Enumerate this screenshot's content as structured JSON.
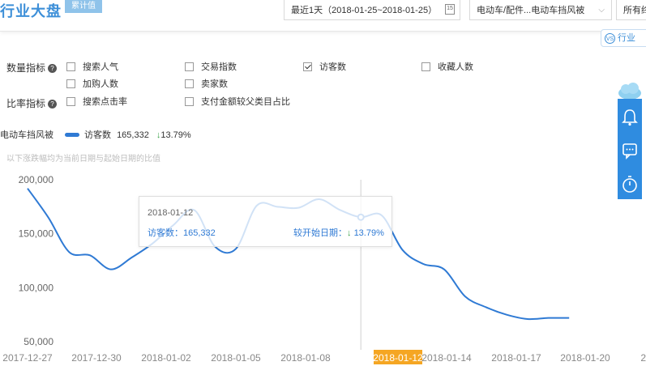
{
  "header": {
    "title": "行业大盘",
    "badge": "累计值",
    "date_range": "最近1天（2018-01-25~2018-01-25）",
    "calendar_icon_text": "15",
    "category": "电动车/配件...电动车挡风被",
    "all_select": "所有终",
    "industry_tab": "行业",
    "vs_icon_text": "VS"
  },
  "filters": {
    "quantity_label": "数量指标",
    "rate_label": "比率指标",
    "help_icon_text": "?",
    "items": [
      {
        "label": "搜索人气",
        "checked": false
      },
      {
        "label": "交易指数",
        "checked": false
      },
      {
        "label": "访客数",
        "checked": true
      },
      {
        "label": "收藏人数",
        "checked": false
      },
      {
        "label": "加购人数",
        "checked": false
      },
      {
        "label": "卖家数",
        "checked": false
      },
      {
        "label": "搜索点击率",
        "checked": false
      },
      {
        "label": "支付金额较父类目占比",
        "checked": false
      }
    ]
  },
  "legend": {
    "category": "电动车挡风被",
    "series_label": "访客数",
    "value": "165,332",
    "change": "13.79%",
    "arrow": "↓"
  },
  "note": "以下涨跌幅均为当前日期与起始日期的比值",
  "tooltip": {
    "date": "2018-01-12",
    "left_label": "访客数：",
    "left_value": "165,332",
    "right_label": "较开始日期：",
    "arrow": "↓",
    "change": "13.79%"
  },
  "colors": {
    "accent": "#3d8fd8",
    "line": "#2f7ad4",
    "highlight": "#f5a623",
    "down_green": "#3ba34a",
    "side_panel": "#2f8ce0"
  },
  "icons": [
    "help-icon",
    "calendar-icon",
    "chevron-down-icon",
    "vs-icon",
    "cloud-icon",
    "bell-icon",
    "chat-icon",
    "timer-icon"
  ],
  "chart_data": {
    "type": "line",
    "title": "",
    "xlabel": "",
    "ylabel": "",
    "ylim": [
      50000,
      200000
    ],
    "ytick_labels": [
      "200,000",
      "150,000",
      "100,000",
      "50,000"
    ],
    "yticks": [
      200000,
      150000,
      100000,
      50000
    ],
    "xtick_labels": [
      "2017-12-27",
      "2017-12-30",
      "2018-01-02",
      "2018-01-05",
      "2018-01-08",
      "2018-01-12",
      "2018-01-14",
      "2018-01-17",
      "2018-01-20",
      "20"
    ],
    "highlighted_tick": "2018-01-12",
    "grid": false,
    "series": [
      {
        "name": "访客数",
        "x": [
          "2017-12-27",
          "2017-12-28",
          "2017-12-29",
          "2017-12-30",
          "2017-12-31",
          "2018-01-01",
          "2018-01-02",
          "2018-01-03",
          "2018-01-04",
          "2018-01-05",
          "2018-01-06",
          "2018-01-07",
          "2018-01-08",
          "2018-01-09",
          "2018-01-10",
          "2018-01-11",
          "2018-01-12",
          "2018-01-13",
          "2018-01-14",
          "2018-01-15",
          "2018-01-16",
          "2018-01-17",
          "2018-01-18",
          "2018-01-19",
          "2018-01-20",
          "2018-01-21",
          "2018-01-22"
        ],
        "values": [
          192000,
          165000,
          133000,
          130000,
          117000,
          128000,
          141000,
          158000,
          172000,
          138000,
          136000,
          176000,
          175000,
          174000,
          182000,
          172000,
          165332,
          167000,
          135000,
          122000,
          117000,
          92000,
          82000,
          75000,
          71000,
          72000,
          72000
        ]
      }
    ]
  }
}
